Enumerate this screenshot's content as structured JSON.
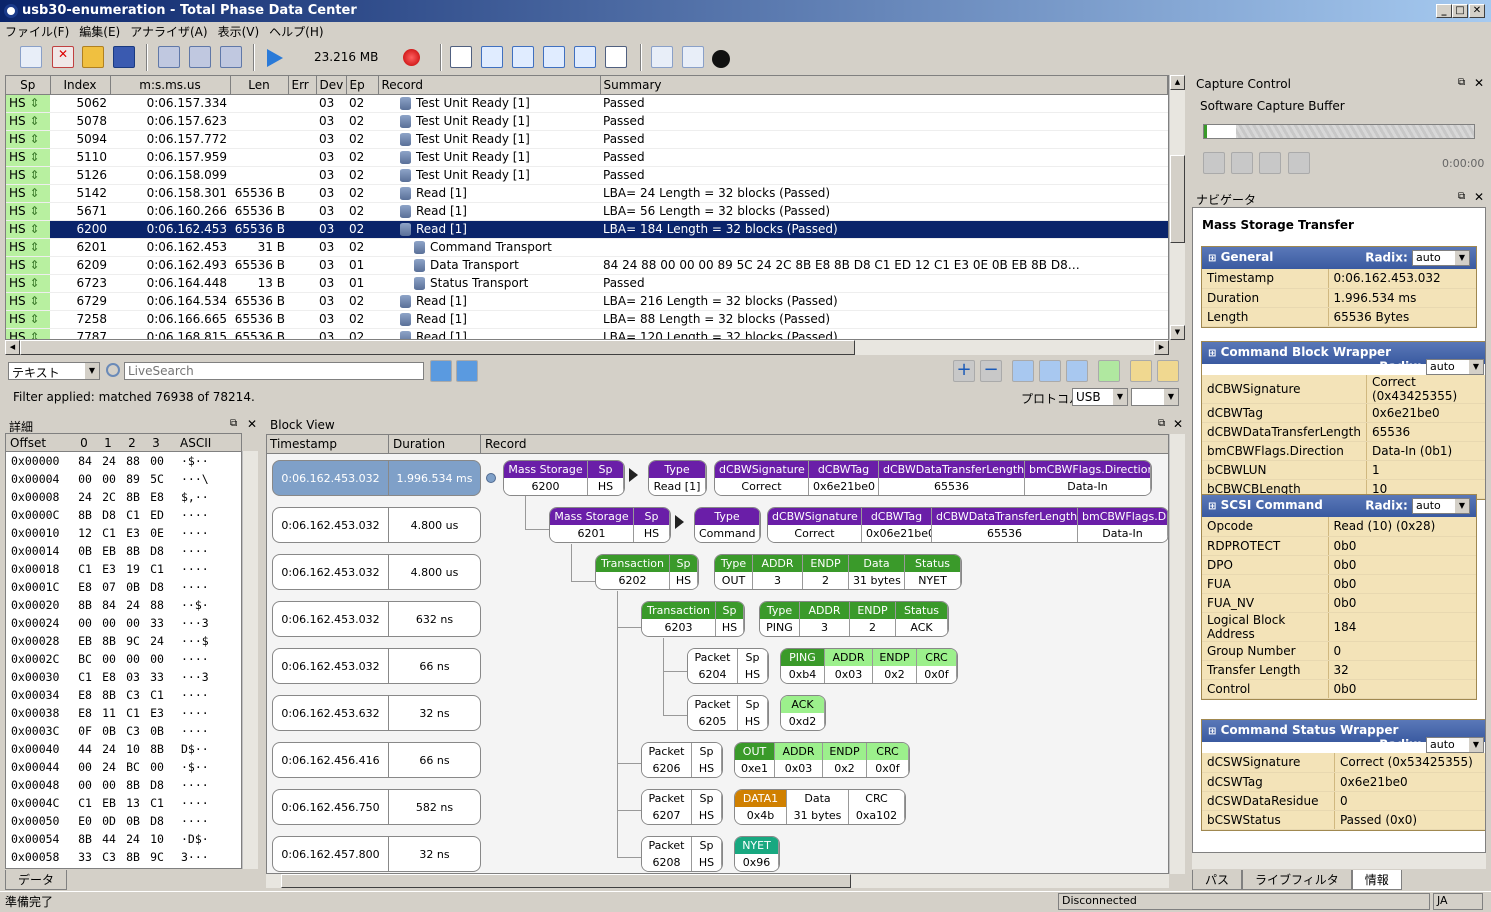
{
  "window": {
    "title": "usb30-enumeration - Total Phase Data Center",
    "btn_min": "_",
    "btn_max": "□",
    "btn_close": "✕"
  },
  "menu": [
    "ファイル(F)",
    "編集(E)",
    "アナライザ(A)",
    "表示(V)",
    "ヘルプ(H)"
  ],
  "toolbar": {
    "mem": "23.216 MB"
  },
  "columns": [
    "Sp",
    "Index",
    "m:s.ms.us",
    "Len",
    "Err",
    "Dev",
    "Ep",
    "Record",
    "Summary"
  ],
  "rows": [
    {
      "sp": "HS",
      "idx": "5062",
      "time": "0:06.157.334",
      "len": "",
      "dev": "03",
      "ep": "02",
      "rec": "Test Unit Ready [1]",
      "sum": "Passed",
      "indent": 0
    },
    {
      "sp": "HS",
      "idx": "5078",
      "time": "0:06.157.623",
      "len": "",
      "dev": "03",
      "ep": "02",
      "rec": "Test Unit Ready [1]",
      "sum": "Passed",
      "indent": 0
    },
    {
      "sp": "HS",
      "idx": "5094",
      "time": "0:06.157.772",
      "len": "",
      "dev": "03",
      "ep": "02",
      "rec": "Test Unit Ready [1]",
      "sum": "Passed",
      "indent": 0
    },
    {
      "sp": "HS",
      "idx": "5110",
      "time": "0:06.157.959",
      "len": "",
      "dev": "03",
      "ep": "02",
      "rec": "Test Unit Ready [1]",
      "sum": "Passed",
      "indent": 0
    },
    {
      "sp": "HS",
      "idx": "5126",
      "time": "0:06.158.099",
      "len": "",
      "dev": "03",
      "ep": "02",
      "rec": "Test Unit Ready [1]",
      "sum": "Passed",
      "indent": 0
    },
    {
      "sp": "HS",
      "idx": "5142",
      "time": "0:06.158.301",
      "len": "65536 B",
      "dev": "03",
      "ep": "02",
      "rec": "Read [1]",
      "sum": "LBA= 24 Length = 32 blocks (Passed)",
      "indent": 0
    },
    {
      "sp": "HS",
      "idx": "5671",
      "time": "0:06.160.266",
      "len": "65536 B",
      "dev": "03",
      "ep": "02",
      "rec": "Read [1]",
      "sum": "LBA= 56 Length = 32 blocks (Passed)",
      "indent": 0
    },
    {
      "sp": "HS",
      "idx": "6200",
      "time": "0:06.162.453",
      "len": "65536 B",
      "dev": "03",
      "ep": "02",
      "rec": "Read [1]",
      "sum": "LBA= 184 Length = 32 blocks (Passed)",
      "indent": 0,
      "selected": true
    },
    {
      "sp": "HS",
      "idx": "6201",
      "time": "0:06.162.453",
      "len": "31 B",
      "dev": "03",
      "ep": "02",
      "rec": "Command Transport",
      "sum": "",
      "indent": 1
    },
    {
      "sp": "HS",
      "idx": "6209",
      "time": "0:06.162.493",
      "len": "65536 B",
      "dev": "03",
      "ep": "01",
      "rec": "Data Transport",
      "sum": "84 24 88 00 00 00 89 5C 24 2C 8B E8 8B D8 C1 ED 12 C1 E3 0E 0B EB 8B D8…",
      "indent": 1
    },
    {
      "sp": "HS",
      "idx": "6723",
      "time": "0:06.164.448",
      "len": "13 B",
      "dev": "03",
      "ep": "01",
      "rec": "Status Transport",
      "sum": "Passed",
      "indent": 1
    },
    {
      "sp": "HS",
      "idx": "6729",
      "time": "0:06.164.534",
      "len": "65536 B",
      "dev": "03",
      "ep": "02",
      "rec": "Read [1]",
      "sum": "LBA= 216 Length = 32 blocks (Passed)",
      "indent": 0
    },
    {
      "sp": "HS",
      "idx": "7258",
      "time": "0:06.166.665",
      "len": "65536 B",
      "dev": "03",
      "ep": "02",
      "rec": "Read [1]",
      "sum": "LBA= 88 Length = 32 blocks (Passed)",
      "indent": 0
    },
    {
      "sp": "HS",
      "idx": "7787",
      "time": "0:06.168.815",
      "len": "65536 B",
      "dev": "03",
      "ep": "02",
      "rec": "Read [1]",
      "sum": "LBA= 120 Length = 32 blocks (Passed)",
      "indent": 0
    }
  ],
  "filter": {
    "mode": "テキスト",
    "placeholder": "LiveSearch",
    "status": "Filter applied: matched 76938 of 78214.",
    "proto_label": "プロトコル:",
    "proto": "USB"
  },
  "detail": {
    "title": "詳細",
    "head": [
      "Offset",
      "0",
      "1",
      "2",
      "3",
      "ASCII"
    ],
    "rows": [
      [
        "0x00000",
        "84",
        "24",
        "88",
        "00",
        "·$··"
      ],
      [
        "0x00004",
        "00",
        "00",
        "89",
        "5C",
        "···\\"
      ],
      [
        "0x00008",
        "24",
        "2C",
        "8B",
        "E8",
        "$,··"
      ],
      [
        "0x0000C",
        "8B",
        "D8",
        "C1",
        "ED",
        "····"
      ],
      [
        "0x00010",
        "12",
        "C1",
        "E3",
        "0E",
        "····"
      ],
      [
        "0x00014",
        "0B",
        "EB",
        "8B",
        "D8",
        "····"
      ],
      [
        "0x00018",
        "C1",
        "E3",
        "19",
        "C1",
        "····"
      ],
      [
        "0x0001C",
        "E8",
        "07",
        "0B",
        "D8",
        "····"
      ],
      [
        "0x00020",
        "8B",
        "84",
        "24",
        "88",
        "··$·"
      ],
      [
        "0x00024",
        "00",
        "00",
        "00",
        "33",
        "···3"
      ],
      [
        "0x00028",
        "EB",
        "8B",
        "9C",
        "24",
        "···$"
      ],
      [
        "0x0002C",
        "BC",
        "00",
        "00",
        "00",
        "····"
      ],
      [
        "0x00030",
        "C1",
        "E8",
        "03",
        "33",
        "···3"
      ],
      [
        "0x00034",
        "E8",
        "8B",
        "C3",
        "C1",
        "····"
      ],
      [
        "0x00038",
        "E8",
        "11",
        "C1",
        "E3",
        "····"
      ],
      [
        "0x0003C",
        "0F",
        "0B",
        "C3",
        "0B",
        "····"
      ],
      [
        "0x00040",
        "44",
        "24",
        "10",
        "8B",
        "D$··"
      ],
      [
        "0x00044",
        "00",
        "24",
        "BC",
        "00",
        "·$··"
      ],
      [
        "0x00048",
        "00",
        "00",
        "8B",
        "D8",
        "····"
      ],
      [
        "0x0004C",
        "C1",
        "EB",
        "13",
        "C1",
        "····"
      ],
      [
        "0x00050",
        "E0",
        "0D",
        "0B",
        "D8",
        "····"
      ],
      [
        "0x00054",
        "8B",
        "44",
        "24",
        "10",
        "·D$·"
      ],
      [
        "0x00058",
        "33",
        "C3",
        "8B",
        "9C",
        "3···"
      ]
    ],
    "tab": "データ"
  },
  "block_view": {
    "title": "Block View",
    "head": [
      "Timestamp",
      "Duration",
      "Record"
    ],
    "times": [
      [
        "0:06.162.453.032",
        "1.996.534 ms"
      ],
      [
        "0:06.162.453.032",
        "4.800 us"
      ],
      [
        "0:06.162.453.032",
        "4.800 us"
      ],
      [
        "0:06.162.453.032",
        "632 ns"
      ],
      [
        "0:06.162.453.032",
        "66 ns"
      ],
      [
        "0:06.162.453.632",
        "32 ns"
      ],
      [
        "0:06.162.456.416",
        "66 ns"
      ],
      [
        "0:06.162.456.750",
        "582 ns"
      ],
      [
        "0:06.162.457.800",
        "32 ns"
      ]
    ],
    "b1": {
      "ms": "Mass Storage",
      "sp": "Sp",
      "msv": "6200",
      "spv": "HS",
      "type": "Type",
      "typev": "Read [1]",
      "sig": "dCBWSignature",
      "sigv": "Correct",
      "tag": "dCBWTag",
      "tagv": "0x6e21be0",
      "dtl": "dCBWDataTransferLength",
      "dtlv": "65536",
      "flags": "bmCBWFlags.Direction",
      "flagsv": "Data-In"
    },
    "b2": {
      "ms": "Mass Storage",
      "sp": "Sp",
      "msv": "6201",
      "spv": "HS",
      "type": "Type",
      "typev": "Command",
      "sig": "dCBWSignature",
      "sigv": "Correct",
      "tag": "dCBWTag",
      "tagv": "0x06e21be0",
      "dtl": "dCBWDataTransferLength",
      "dtlv": "65536",
      "flags": "bmCBWFlags.D",
      "flagsv": "Data-In"
    },
    "b3": {
      "t": "Transaction",
      "sp": "Sp",
      "tv": "6202",
      "spv": "HS",
      "type": "Type",
      "addr": "ADDR",
      "endp": "ENDP",
      "data": "Data",
      "status": "Status",
      "typev": "OUT",
      "addrv": "3",
      "endpv": "2",
      "datav": "31 bytes",
      "statusv": "NYET"
    },
    "b4": {
      "t": "Transaction",
      "sp": "Sp",
      "tv": "6203",
      "spv": "HS",
      "type": "Type",
      "addr": "ADDR",
      "endp": "ENDP",
      "status": "Status",
      "typev": "PING",
      "addrv": "3",
      "endpv": "2",
      "statusv": "ACK"
    },
    "b5": {
      "p": "Packet",
      "sp": "Sp",
      "pv": "6204",
      "spv": "HS",
      "pid": "PING",
      "addr": "ADDR",
      "endp": "ENDP",
      "crc": "CRC",
      "pidv": "0xb4",
      "addrv": "0x03",
      "endpv": "0x2",
      "crcv": "0x0f"
    },
    "b6": {
      "p": "Packet",
      "sp": "Sp",
      "pv": "6205",
      "spv": "HS",
      "pid": "ACK",
      "pidv": "0xd2"
    },
    "b7": {
      "p": "Packet",
      "sp": "Sp",
      "pv": "6206",
      "spv": "HS",
      "pid": "OUT",
      "addr": "ADDR",
      "endp": "ENDP",
      "crc": "CRC",
      "pidv": "0xe1",
      "addrv": "0x03",
      "endpv": "0x2",
      "crcv": "0x0f"
    },
    "b8": {
      "p": "Packet",
      "sp": "Sp",
      "pv": "6207",
      "spv": "HS",
      "pid": "DATA1",
      "data": "Data",
      "crc": "CRC",
      "pidv": "0x4b",
      "datav": "31 bytes",
      "crcv": "0xa102"
    },
    "b9": {
      "p": "Packet",
      "sp": "Sp",
      "pv": "6208",
      "spv": "HS",
      "pid": "NYET",
      "pidv": "0x96"
    }
  },
  "capture": {
    "title": "Capture Control",
    "buffer": "Software Capture Buffer",
    "time": "0:00:00",
    "progress": 0.12
  },
  "nav": {
    "title": "ナビゲータ",
    "heading": "Mass Storage Transfer",
    "radix_label": "Radix:",
    "radix": "auto",
    "general": {
      "title": "General",
      "rows": [
        [
          "Timestamp",
          "0:06.162.453.032"
        ],
        [
          "Duration",
          "1.996.534 ms"
        ],
        [
          "Length",
          "65536 Bytes"
        ]
      ]
    },
    "cbw": {
      "title": "Command Block Wrapper",
      "rows": [
        [
          "dCBWSignature",
          "Correct (0x43425355)"
        ],
        [
          "dCBWTag",
          "0x6e21be0"
        ],
        [
          "dCBWDataTransferLength",
          "65536"
        ],
        [
          "bmCBWFlags.Direction",
          "Data-In (0b1)"
        ],
        [
          "bCBWLUN",
          "1"
        ],
        [
          "bCBWCBLength",
          "10"
        ]
      ]
    },
    "scsi": {
      "title": "SCSI Command",
      "rows": [
        [
          "Opcode",
          "Read (10) (0x28)"
        ],
        [
          "RDPROTECT",
          "0b0"
        ],
        [
          "DPO",
          "0b0"
        ],
        [
          "FUA",
          "0b0"
        ],
        [
          "FUA_NV",
          "0b0"
        ],
        [
          "Logical Block Address",
          "184"
        ],
        [
          "Group Number",
          "0"
        ],
        [
          "Transfer Length",
          "32"
        ],
        [
          "Control",
          "0b0"
        ]
      ]
    },
    "csw": {
      "title": "Command Status Wrapper",
      "rows": [
        [
          "dCSWSignature",
          "Correct (0x53425355)"
        ],
        [
          "dCSWTag",
          "0x6e21be0"
        ],
        [
          "dCSWDataResidue",
          "0"
        ],
        [
          "bCSWStatus",
          "Passed (0x0)"
        ]
      ]
    },
    "tabs": [
      "パス",
      "ライブフィルタ",
      "情報"
    ]
  },
  "status": {
    "left": "準備完了",
    "conn": "Disconnected",
    "lang": "JA"
  },
  "colors": {
    "selection": "#0a246a",
    "hs": "#b8f0a0",
    "purple": "#6a1ea8",
    "green": "#3a9a2a",
    "nav_header": "#3a5aa0",
    "nav_row": "#f3e3b8"
  }
}
